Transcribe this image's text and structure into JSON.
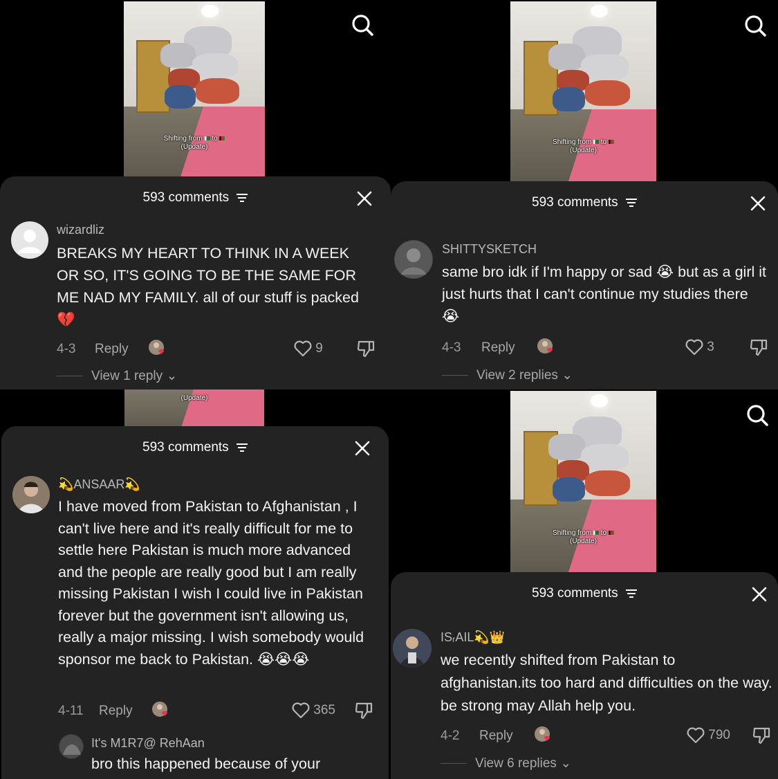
{
  "panels": [
    {
      "caption_line1": "Shifting from",
      "caption_to": "to",
      "caption_line2": "(Update)",
      "comments_count": "593 comments",
      "username": "wizardliz",
      "comment": "BREAKS MY HEART TO THINK IN A WEEK OR SO, IT'S GOING TO BE THE SAME FOR ME NAD MY FAMILY. all of our stuff is packed💔",
      "date": "4-3",
      "reply_label": "Reply",
      "likes": "9",
      "view_replies": "View 1 reply"
    },
    {
      "caption_line1": "Shifting from",
      "caption_to": "to",
      "caption_line2": "(Update)",
      "comments_count": "593 comments",
      "username": "SHITTYSKETCH",
      "comment": "same bro idk if I'm happy or sad 😭 but as a girl it just hurts that I can't continue my studies there 😭",
      "date": "4-3",
      "reply_label": "Reply",
      "likes": "3",
      "view_replies": "View 2 replies"
    },
    {
      "caption_line2": "(Update)",
      "comments_count": "593 comments",
      "username": "💫ANSAAR💫",
      "comment": "I have moved from Pakistan to Afghanistan , I can't live here and it's really difficult for me to settle here Pakistan is much more advanced and the people are really good but I am really missing Pakistan I wish I could live in Pakistan forever but the government isn't allowing us, really a major missing. I wish somebody would sponsor me back to Pakistan. 😭😭😭",
      "date": "4-11",
      "reply_label": "Reply",
      "likes": "365",
      "sub_username": "It's M1R7@ RehAan",
      "sub_comment": "bro this happened because of your"
    },
    {
      "caption_line1": "Shifting from",
      "caption_to": "to",
      "caption_line2": "(Update)",
      "comments_count": "593 comments",
      "username": "ISᵣAIL💫👑",
      "comment": "we recently shifted from Pakistan to afghanistan.its too hard and difficulties on the way. be strong may Allah help you.",
      "date": "4-2",
      "reply_label": "Reply",
      "likes": "790",
      "view_replies": "View 6 replies"
    }
  ],
  "colors": {
    "sheet_bg": "#232323",
    "rug": "#e06a85",
    "heart_badge": "#e8344a"
  }
}
